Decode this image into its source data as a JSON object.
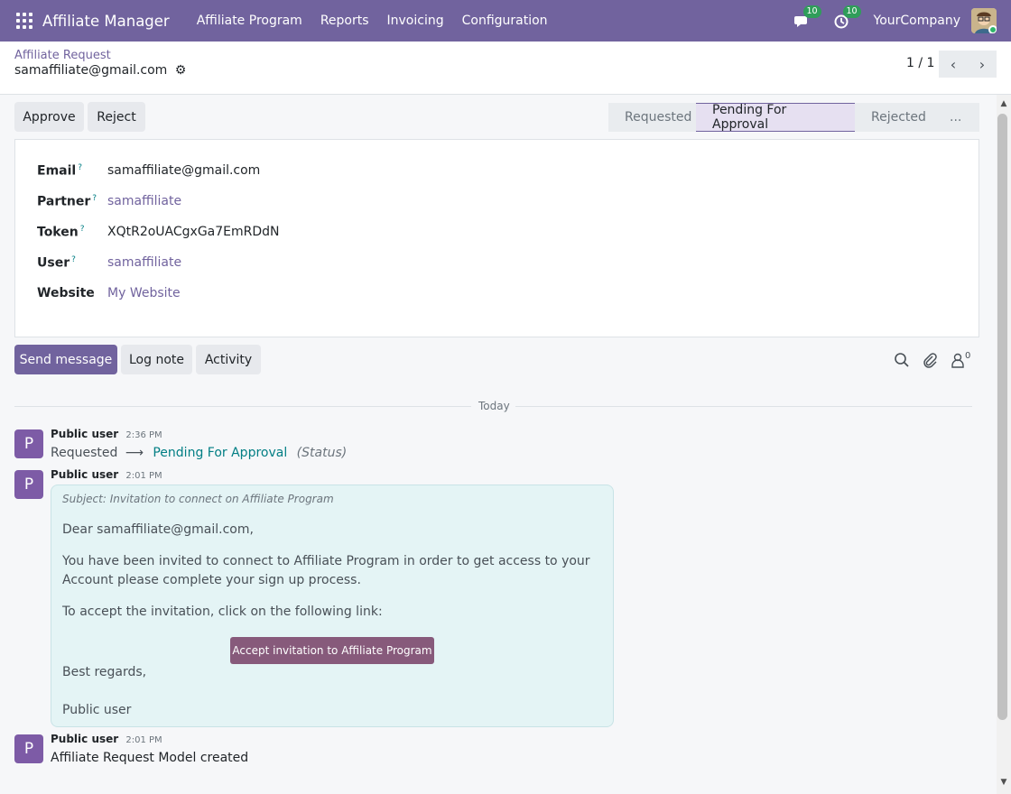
{
  "navbar": {
    "app_name": "Affiliate Manager",
    "menu": [
      "Affiliate Program",
      "Reports",
      "Invoicing",
      "Configuration"
    ],
    "messages_count": "10",
    "activities_count": "10",
    "company": "YourCompany"
  },
  "breadcrumb": {
    "parent": "Affiliate Request",
    "current": "samaffiliate@gmail.com"
  },
  "pager": {
    "value": "1 / 1"
  },
  "actions": {
    "approve": "Approve",
    "reject": "Reject"
  },
  "statusbar": {
    "stages": [
      "Requested",
      "Pending For Approval",
      "Rejected",
      "..."
    ],
    "active": "Pending For Approval"
  },
  "form": {
    "fields": [
      {
        "label": "Email",
        "help": "?",
        "value": "samaffiliate@gmail.com"
      },
      {
        "label": "Partner",
        "help": "?",
        "value": "samaffiliate"
      },
      {
        "label": "Token",
        "help": "?",
        "value": "XQtR2oUACgxGa7EmRDdN"
      },
      {
        "label": "User",
        "help": "?",
        "value": "samaffiliate"
      },
      {
        "label": "Website",
        "help": "",
        "value": "My Website"
      }
    ]
  },
  "chatter": {
    "send_message": "Send message",
    "log_note": "Log note",
    "activity": "Activity",
    "followers_count": "0",
    "date_separator": "Today",
    "messages": [
      {
        "author": "Public user",
        "time": "2:36 PM",
        "tracking_old": "Requested",
        "tracking_arrow": "⟶",
        "tracking_new": "Pending For Approval",
        "tracking_field": "(Status)"
      },
      {
        "author": "Public user",
        "time": "2:01 PM",
        "subject": "Subject: Invitation to connect on Affiliate Program",
        "greeting": "Dear samaffiliate@gmail.com,",
        "body1": "You have been invited to connect to Affiliate Program in order to get access to your Account please complete your sign up process.",
        "body2": "To accept the invitation, click on the following link:",
        "button": "Accept invitation to Affiliate Program",
        "regards": "Best regards,",
        "signature": "Public user"
      },
      {
        "author": "Public user",
        "time": "2:01 PM",
        "body": "Affiliate Request Model created"
      }
    ]
  },
  "colors": {
    "brand": "#71639e",
    "accent_teal": "#017e84",
    "badge_green": "#2f9d5a",
    "mail_bubble": "#e4f4f5",
    "accept_button": "#875a7b",
    "avatar": "#7d5ba6"
  }
}
